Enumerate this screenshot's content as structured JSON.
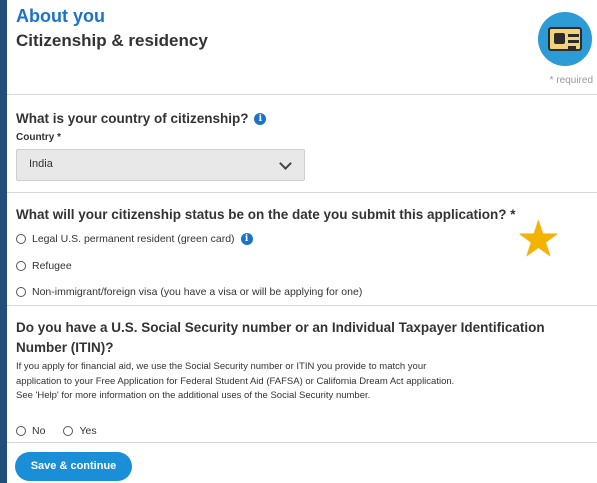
{
  "header": {
    "section_title": "About you",
    "page_title": "Citizenship & residency",
    "required_note": "* required"
  },
  "q_citizenship": {
    "heading": "What is your country of citizenship?",
    "field_label": "Country *",
    "selected_value": "India"
  },
  "q_status": {
    "heading": "What will your citizenship status be on the date you submit this application? *",
    "options": [
      "Legal U.S. permanent resident (green card)",
      "Refugee",
      "Non-immigrant/foreign visa (you have a visa or will be applying for one)"
    ]
  },
  "q_ssn": {
    "heading": "Do you have a U.S. Social Security number or an Individual Taxpayer Identification Number (ITIN)?",
    "help_text": "If you apply for financial aid, we use the Social Security number or ITIN you provide to match your application to your Free Application for Federal Student Aid (FAFSA) or California Dream Act application. See 'Help' for more information on the additional uses of the Social Security number.",
    "options": [
      "No",
      "Yes"
    ]
  },
  "footer": {
    "save_label": "Save & continue"
  },
  "icons": {
    "info": "info-icon",
    "badge": "id-card-icon",
    "star": "star-icon"
  },
  "colors": {
    "accent": "#1a73c9",
    "button": "#1a8fd8",
    "background": "#1f4e79",
    "star": "#f5b301"
  }
}
